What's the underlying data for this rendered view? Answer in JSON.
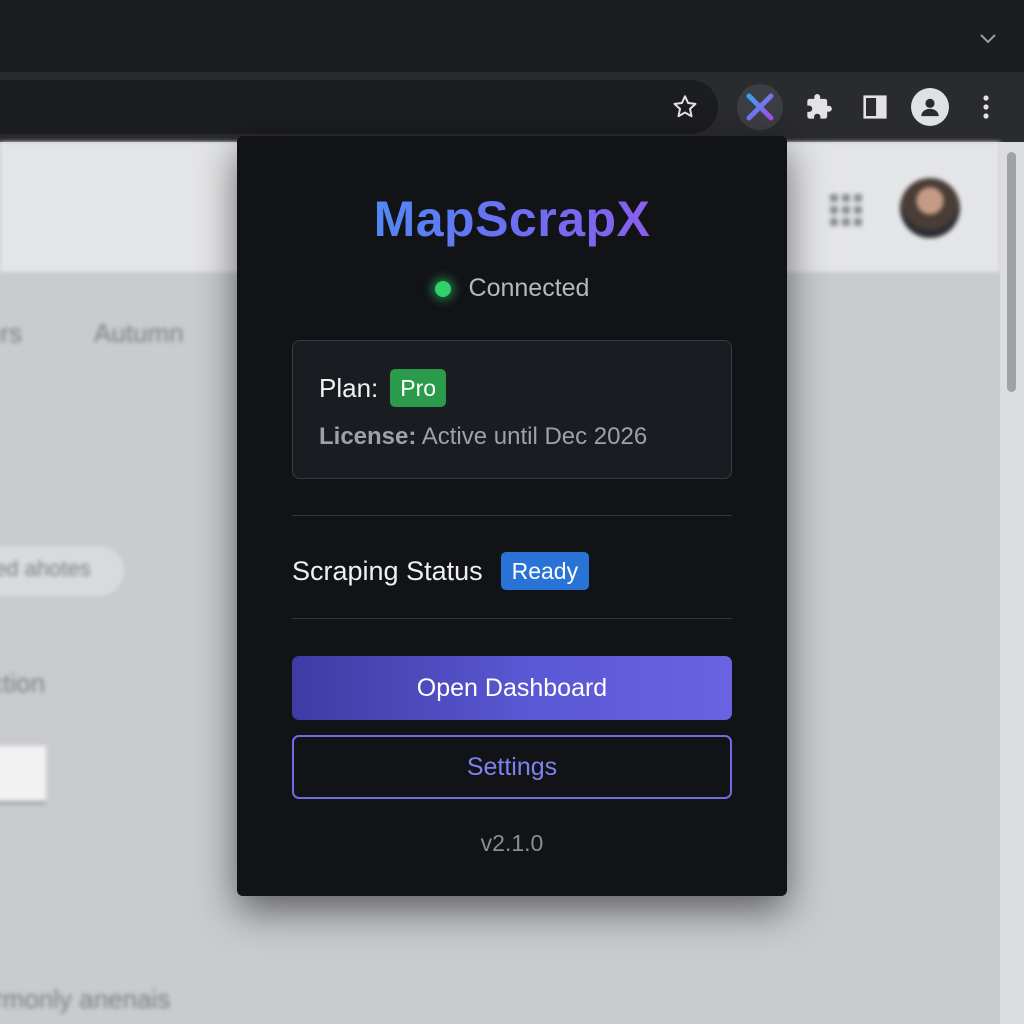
{
  "popup": {
    "brand": "MapScrapX",
    "connection": {
      "status": "Connected",
      "color": "#2fd26a"
    },
    "plan": {
      "label": "Plan:",
      "badge": "Pro",
      "badge_color": "#2c9a4b"
    },
    "license": {
      "label": "License:",
      "value": "Active until Dec 2026"
    },
    "scraping": {
      "label": "Scraping Status",
      "badge": "Ready",
      "badge_color": "#2a73d6"
    },
    "buttons": {
      "primary": "Open Dashboard",
      "secondary": "Settings"
    },
    "version": "v2.1.0"
  },
  "browser": {
    "toolbar_icons": [
      "star-icon",
      "mapscrapx-extension-icon",
      "extensions-puzzle-icon",
      "side-panel-icon",
      "profile-icon",
      "more-menu-icon"
    ],
    "tabstrip_icons": [
      "chevron-down-icon"
    ]
  },
  "background_page": {
    "fragments": [
      "ers",
      "Autumn",
      "ed ahotes",
      "ction",
      "rmonly anenais"
    ]
  },
  "colors": {
    "accent_gradient": [
      "#38a1f5",
      "#6b6ff2",
      "#a94ee6"
    ],
    "popup_bg": "#121317",
    "primary_button": "#5a58d4"
  }
}
